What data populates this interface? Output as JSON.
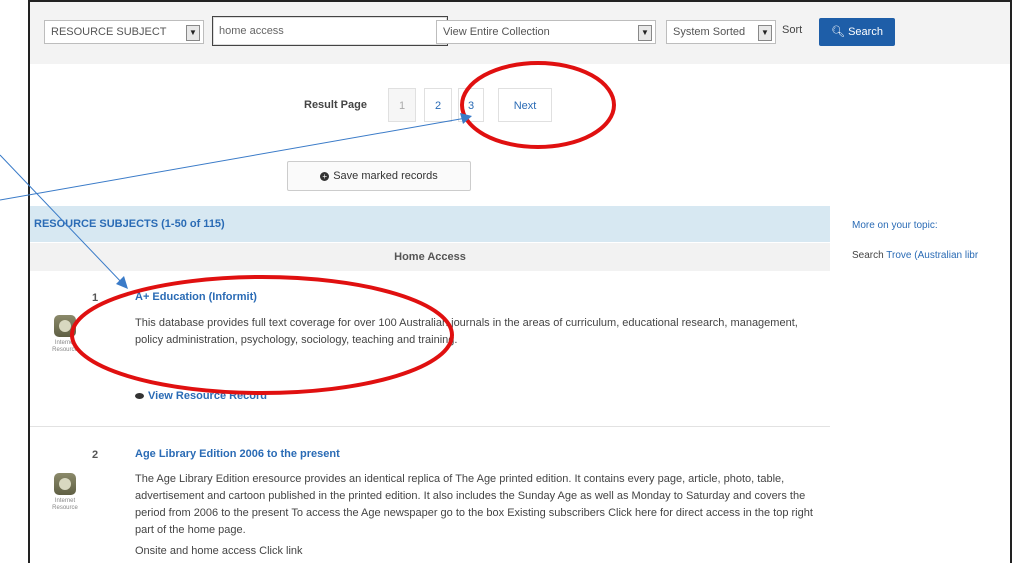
{
  "toolbar": {
    "field_select": "RESOURCE SUBJECT",
    "search_value": "home access",
    "collection_select": "View Entire Collection",
    "sort_select": "System Sorted",
    "sort_label": "Sort",
    "search_button": "Search"
  },
  "pager": {
    "label": "Result Page",
    "pages": [
      "1",
      "2",
      "3"
    ],
    "next": "Next"
  },
  "save_button": "Save marked records",
  "results": {
    "header": "RESOURCE SUBJECTS (1-50 of 115)",
    "subheading": "Home Access",
    "items": [
      {
        "num": "1",
        "title": "A+ Education (Informit)",
        "description": "This database provides full text coverage for over 100 Australian journals in the areas of curriculum, educational research, management, policy administration, psychology, sociology, teaching and training.",
        "icon_label": "Internet Resource",
        "view_label": "View Resource Record"
      },
      {
        "num": "2",
        "title": "Age Library Edition 2006 to the present",
        "description": "The Age Library Edition eresource provides an identical replica of The Age printed edition. It contains every page, article, photo, table, advertisement and cartoon published in the printed edition. It also includes the Sunday Age as well as Monday to Saturday and covers the period from 2006 to the present To access the Age newspaper go to the box Existing subscribers Click here for direct access in the top right part of the home page.",
        "extra_line": "Onsite and home access Click link",
        "icon_label": "Internet Resource"
      }
    ]
  },
  "sidebar": {
    "more_label": "More on your topic:",
    "search_prefix": "Search",
    "search_link": "Trove (Australian libr"
  },
  "colors": {
    "accent": "#2a6bb5",
    "header_bg": "#d7e8f2",
    "annotation_red": "#e01010",
    "arrow_blue": "#3a7bc8"
  }
}
